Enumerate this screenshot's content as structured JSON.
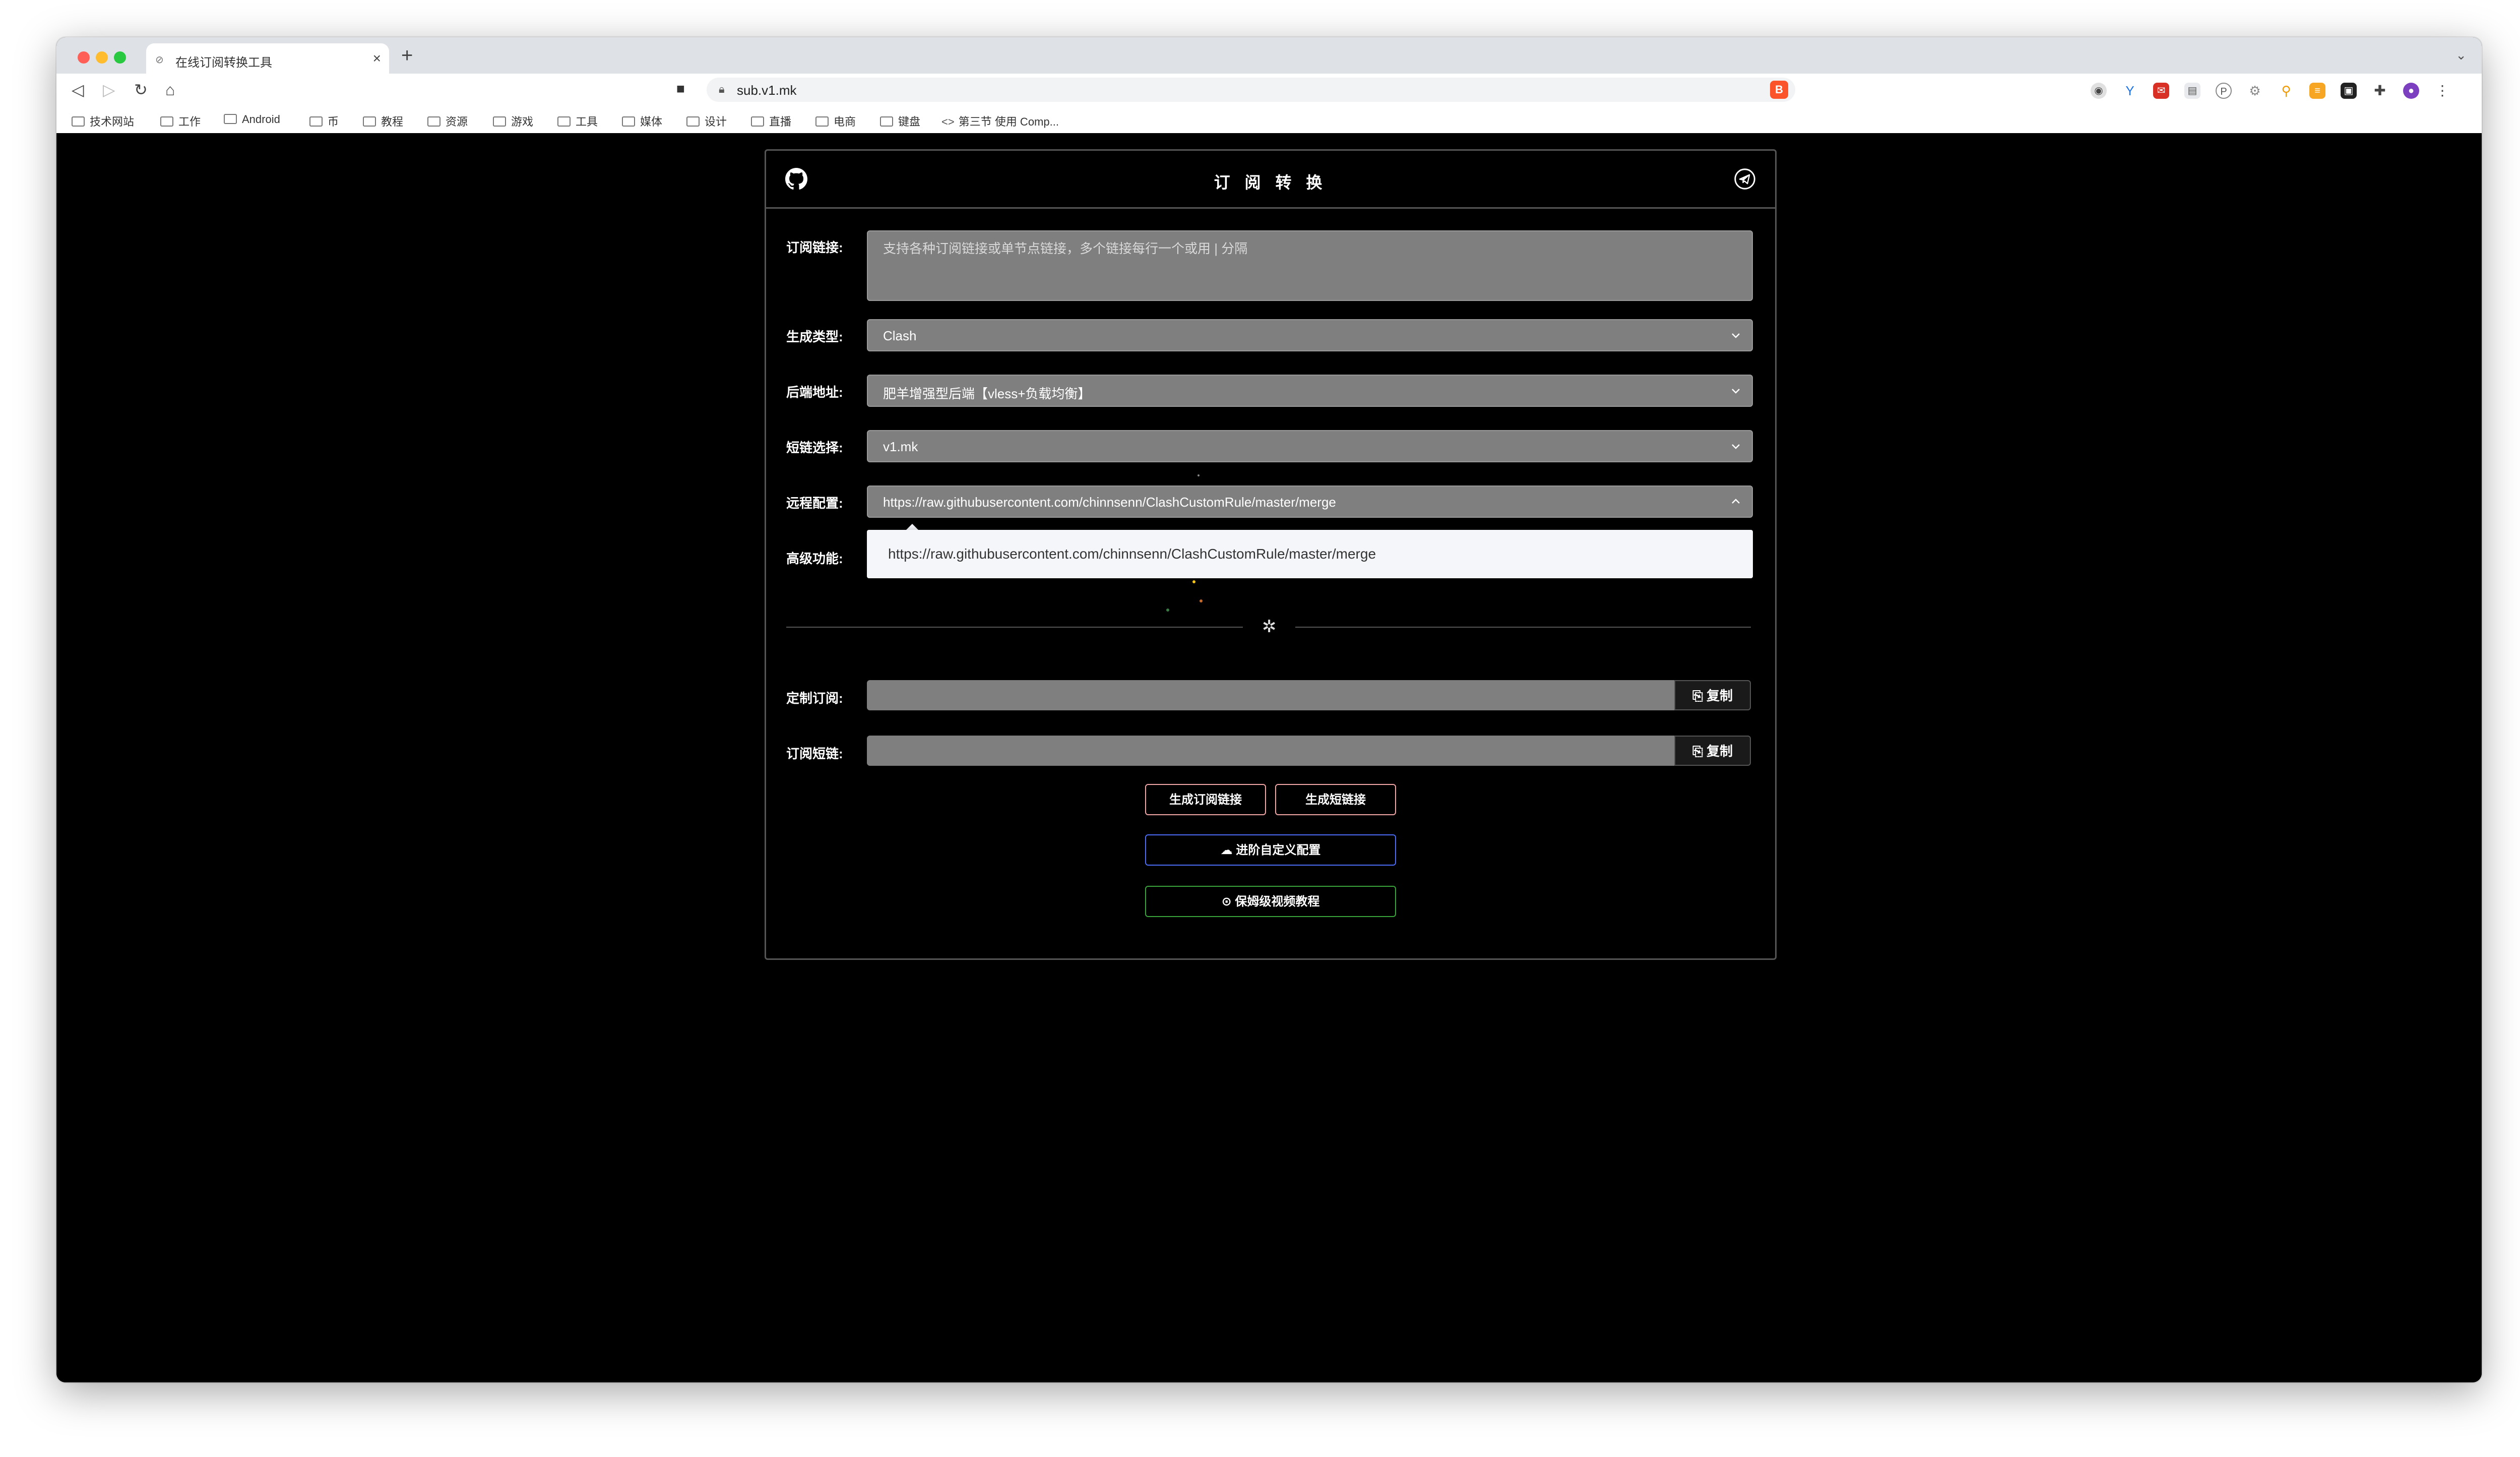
{
  "browser": {
    "tab_title": "在线订阅转换工具",
    "tab_favicon": "subconverter-icon",
    "url": "sub.v1.mk",
    "bookmarks": [
      {
        "label": "技术网站"
      },
      {
        "label": "工作"
      },
      {
        "label": "Android"
      },
      {
        "label": "币"
      },
      {
        "label": "教程"
      },
      {
        "label": "资源"
      },
      {
        "label": "游戏"
      },
      {
        "label": "工具"
      },
      {
        "label": "媒体"
      },
      {
        "label": "设计"
      },
      {
        "label": "直播"
      },
      {
        "label": "电商"
      },
      {
        "label": "键盘"
      },
      {
        "label": "第三节 使用 Comp..."
      }
    ],
    "extension_icons": [
      "chrome-icon",
      "vpn-icon",
      "mail-badge-icon",
      "calendar-icon",
      "pinterest-icon",
      "settings-icon",
      "location-icon",
      "notes-icon",
      "extension-badge-icon",
      "puzzle-icon",
      "avatar-icon",
      "menu-icon"
    ]
  },
  "card": {
    "title": "订 阅 转 换",
    "github_icon": "github-icon",
    "telegram_icon": "telegram-icon"
  },
  "form": {
    "subscription": {
      "label": "订阅链接:",
      "placeholder": "支持各种订阅链接或单节点链接，多个链接每行一个或用 | 分隔"
    },
    "target": {
      "label": "生成类型:",
      "value": "Clash"
    },
    "backend": {
      "label": "后端地址:",
      "value": "肥羊增强型后端【vless+负载均衡】"
    },
    "shortlink": {
      "label": "短链选择:",
      "value": "v1.mk"
    },
    "remote_config": {
      "label": "远程配置:",
      "value": "https://raw.githubusercontent.com/chinnsenn/ClashCustomRule/master/merge"
    },
    "advanced": {
      "label": "高级功能:"
    },
    "dropdown_option": "https://raw.githubusercontent.com/chinnsenn/ClashCustomRule/master/merge",
    "custom_sub": {
      "label": "定制订阅:",
      "value": ""
    },
    "short_sub": {
      "label": "订阅短链:",
      "value": ""
    },
    "copy_label": "复制"
  },
  "actions": {
    "generate_sub": "生成订阅链接",
    "generate_short": "生成短链接",
    "advanced_config": "进阶自定义配置",
    "video_tutorial": "保姆级视频教程"
  },
  "colors": {
    "button_pink_border": "#f2a6a6",
    "button_blue_border": "#4a6cf7",
    "button_green_border": "#3aa53a",
    "field_gray": "#7f7f7f"
  }
}
